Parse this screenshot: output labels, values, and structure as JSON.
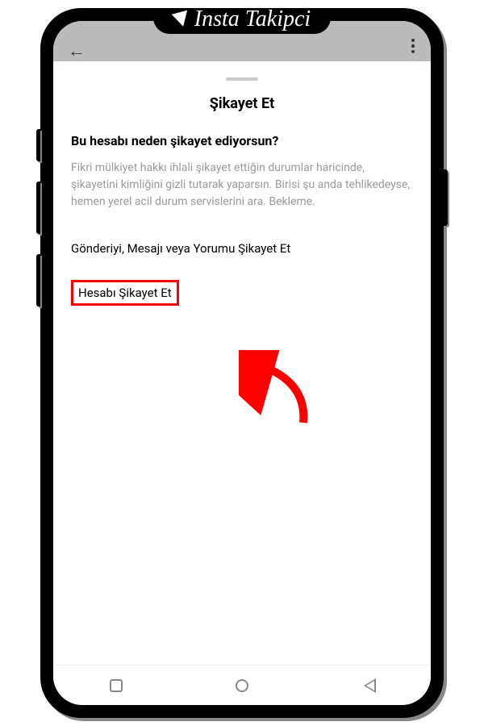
{
  "logo": {
    "text": "Insta Takipci"
  },
  "header": {
    "back_icon": "←"
  },
  "sheet": {
    "title": "Şikayet Et",
    "question": "Bu hesabı neden şikayet ediyorsun?",
    "description": "Fikri mülkiyet hakkı ihlali şikayet ettiğin durumlar haricinde, şikayetini kimliğini gizli tutarak yaparsın. Birisi şu anda tehlikedeyse, hemen yerel acil durum servislerini ara. Bekleme.",
    "options": [
      {
        "label": "Gönderiyi, Mesajı veya Yorumu Şikayet Et",
        "highlighted": false
      },
      {
        "label": "Hesabı Şikayet Et",
        "highlighted": true
      }
    ]
  },
  "annotation": {
    "color": "#ff0000",
    "type": "curved-arrow"
  }
}
